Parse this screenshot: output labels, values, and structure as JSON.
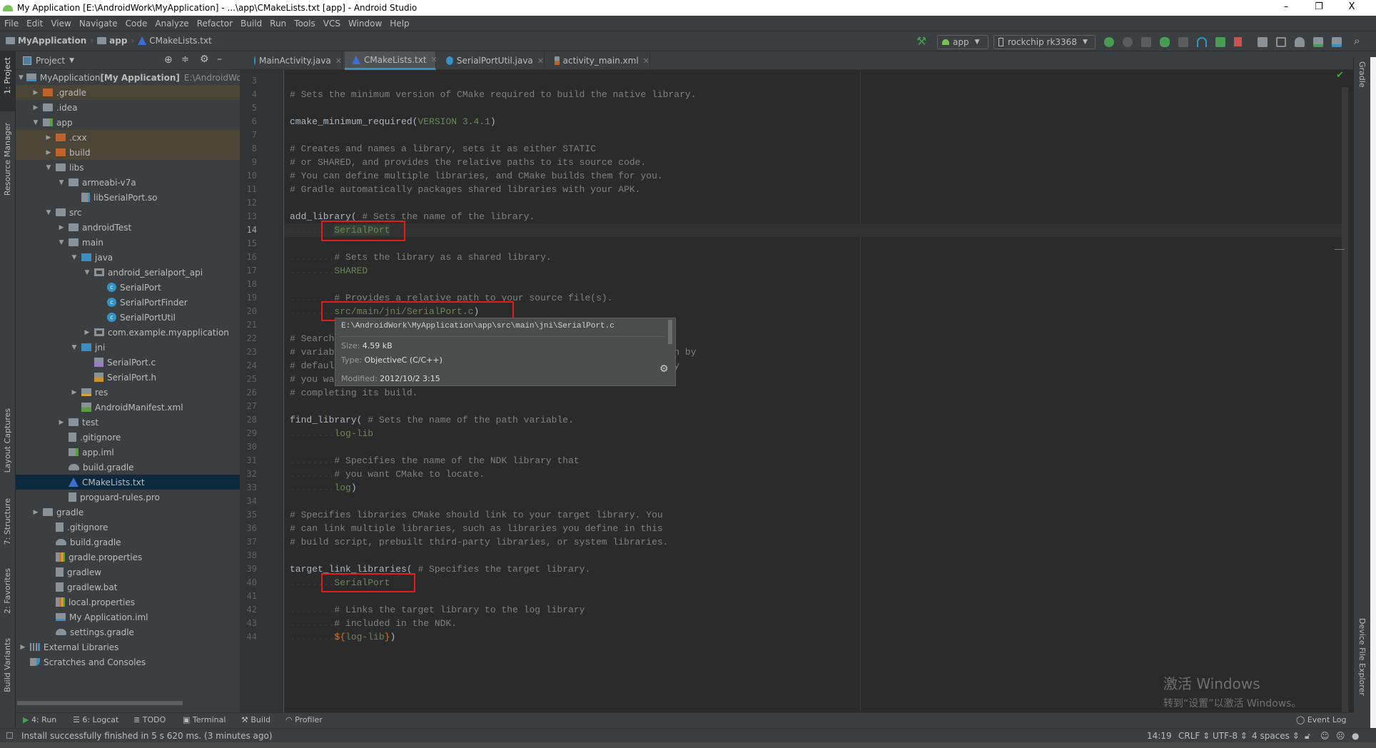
{
  "window": {
    "title": "My Application [E:\\AndroidWork\\MyApplication] - ...\\app\\CMakeLists.txt [app] - Android Studio",
    "controls": [
      "–",
      "❐",
      "X"
    ]
  },
  "menu": [
    "File",
    "Edit",
    "View",
    "Navigate",
    "Code",
    "Analyze",
    "Refactor",
    "Build",
    "Run",
    "Tools",
    "VCS",
    "Window",
    "Help"
  ],
  "breadcrumb": [
    "MyApplication",
    "app",
    "CMakeLists.txt"
  ],
  "toolbar": {
    "run_config": "app",
    "device": "rockchip rk3368",
    "icons": [
      "hammer-icon",
      "rerun-icon",
      "apply-changes-icon",
      "apply-code-changes-icon",
      "debug-icon",
      "attach-debugger-icon",
      "profile-icon",
      "debug-attach-icon",
      "stop-icon",
      "project-structure-icon",
      "avd-manager-icon",
      "gradle-sync-icon",
      "sdk-manager-icon",
      "device-manager-icon",
      "search-icon"
    ],
    "stop_color": "#c75450",
    "build_color": "#499c54"
  },
  "left_stripe": [
    "1: Project",
    "Resource Manager",
    "Layout Captures",
    "7: Structure",
    "2: Favorites",
    "Build Variants"
  ],
  "right_stripe": [
    "Gradle",
    "Device File Explorer"
  ],
  "project_panel": {
    "title": "Project",
    "tree": [
      {
        "label": "MyApplication",
        "bold": "[My Application]",
        "path": "E:\\AndroidWork\\MyApplication",
        "level": 0,
        "arrow": "down",
        "icon": "module"
      },
      {
        "label": ".gradle",
        "level": 1,
        "arrow": "right",
        "icon": "folder-excluded",
        "state": "excluded"
      },
      {
        "label": ".idea",
        "level": 1,
        "arrow": "right",
        "icon": "folder"
      },
      {
        "label": "app",
        "level": 1,
        "arrow": "down",
        "icon": "module-app"
      },
      {
        "label": ".cxx",
        "level": 2,
        "arrow": "right",
        "icon": "folder-excluded",
        "state": "excluded"
      },
      {
        "label": "build",
        "level": 2,
        "arrow": "right",
        "icon": "folder-excluded",
        "state": "excluded"
      },
      {
        "label": "libs",
        "level": 2,
        "arrow": "down",
        "icon": "folder"
      },
      {
        "label": "armeabi-v7a",
        "level": 3,
        "arrow": "down",
        "icon": "folder"
      },
      {
        "label": "libSerialPort.so",
        "level": 4,
        "icon": "so"
      },
      {
        "label": "src",
        "level": 2,
        "arrow": "down",
        "icon": "folder"
      },
      {
        "label": "androidTest",
        "level": 3,
        "arrow": "right",
        "icon": "folder"
      },
      {
        "label": "main",
        "level": 3,
        "arrow": "down",
        "icon": "folder"
      },
      {
        "label": "java",
        "level": 4,
        "arrow": "down",
        "icon": "folder-source"
      },
      {
        "label": "android_serialport_api",
        "level": 5,
        "arrow": "down",
        "icon": "package"
      },
      {
        "label": "SerialPort",
        "level": 6,
        "icon": "class"
      },
      {
        "label": "SerialPortFinder",
        "level": 6,
        "icon": "class"
      },
      {
        "label": "SerialPortUtil",
        "level": 6,
        "icon": "class"
      },
      {
        "label": "com.example.myapplication",
        "level": 5,
        "arrow": "right",
        "icon": "package"
      },
      {
        "label": "jni",
        "level": 4,
        "arrow": "down",
        "icon": "folder-source"
      },
      {
        "label": "SerialPort.c",
        "level": 5,
        "icon": "file-c"
      },
      {
        "label": "SerialPort.h",
        "level": 5,
        "icon": "file-h"
      },
      {
        "label": "res",
        "level": 4,
        "arrow": "right",
        "icon": "folder-res"
      },
      {
        "label": "AndroidManifest.xml",
        "level": 4,
        "icon": "manifest"
      },
      {
        "label": "test",
        "level": 3,
        "arrow": "right",
        "icon": "folder"
      },
      {
        "label": ".gitignore",
        "level": 3,
        "icon": "file"
      },
      {
        "label": "app.iml",
        "level": 3,
        "icon": "module-app"
      },
      {
        "label": "build.gradle",
        "level": 3,
        "icon": "gradle"
      },
      {
        "label": "CMakeLists.txt",
        "level": 3,
        "icon": "cmake",
        "state": "selected"
      },
      {
        "label": "proguard-rules.pro",
        "level": 3,
        "icon": "file"
      },
      {
        "label": "gradle",
        "level": 1,
        "arrow": "right",
        "icon": "folder"
      },
      {
        "label": ".gitignore",
        "level": 2,
        "icon": "file"
      },
      {
        "label": "build.gradle",
        "level": 2,
        "icon": "gradle"
      },
      {
        "label": "gradle.properties",
        "level": 2,
        "icon": "props"
      },
      {
        "label": "gradlew",
        "level": 2,
        "icon": "file"
      },
      {
        "label": "gradlew.bat",
        "level": 2,
        "icon": "file"
      },
      {
        "label": "local.properties",
        "level": 2,
        "icon": "props"
      },
      {
        "label": "My Application.iml",
        "level": 2,
        "icon": "module"
      },
      {
        "label": "settings.gradle",
        "level": 2,
        "icon": "gradle"
      },
      {
        "label": "External Libraries",
        "level": 0,
        "arrow": "right",
        "icon": "libs"
      },
      {
        "label": "Scratches and Consoles",
        "level": 0,
        "icon": "scratch"
      }
    ]
  },
  "tabs": [
    {
      "label": "MainActivity.java",
      "icon": "class"
    },
    {
      "label": "CMakeLists.txt",
      "icon": "cmake",
      "active": true
    },
    {
      "label": "SerialPortUtil.java",
      "icon": "class"
    },
    {
      "label": "activity_main.xml",
      "icon": "xml"
    }
  ],
  "editor": {
    "current_line": 14,
    "lines": [
      {
        "n": 3,
        "seg": []
      },
      {
        "n": 4,
        "seg": [
          [
            "c",
            "# Sets the minimum version of CMake required to build the native library."
          ]
        ]
      },
      {
        "n": 5,
        "seg": []
      },
      {
        "n": 6,
        "seg": [
          [
            "f",
            "cmake_minimum_required"
          ],
          [
            "p",
            "("
          ],
          [
            "s",
            "VERSION 3.4.1"
          ],
          [
            "p",
            ")"
          ]
        ]
      },
      {
        "n": 7,
        "seg": []
      },
      {
        "n": 8,
        "seg": [
          [
            "c",
            "# Creates and names a library, sets it as either STATIC"
          ]
        ]
      },
      {
        "n": 9,
        "seg": [
          [
            "c",
            "# or SHARED, and provides the relative paths to its source code."
          ]
        ]
      },
      {
        "n": 10,
        "seg": [
          [
            "c",
            "# You can define multiple libraries, and CMake builds them for you."
          ]
        ]
      },
      {
        "n": 11,
        "seg": [
          [
            "c",
            "# Gradle automatically packages shared libraries with your APK."
          ]
        ]
      },
      {
        "n": 12,
        "seg": []
      },
      {
        "n": 13,
        "seg": [
          [
            "f",
            "add_library( "
          ],
          [
            "c",
            "# Sets the name of the library."
          ]
        ]
      },
      {
        "n": 14,
        "seg": [
          [
            "ws",
            "........"
          ],
          [
            "s hl",
            "SerialPort"
          ]
        ]
      },
      {
        "n": 15,
        "seg": []
      },
      {
        "n": 16,
        "seg": [
          [
            "ws",
            "........"
          ],
          [
            "c",
            "# Sets the library as a shared library."
          ]
        ]
      },
      {
        "n": 17,
        "seg": [
          [
            "ws",
            "........"
          ],
          [
            "s",
            "SHARED"
          ]
        ]
      },
      {
        "n": 18,
        "seg": []
      },
      {
        "n": 19,
        "seg": [
          [
            "ws",
            "........"
          ],
          [
            "c",
            "# Provides a relative path to your source file(s)."
          ]
        ]
      },
      {
        "n": 20,
        "seg": [
          [
            "ws",
            "........"
          ],
          [
            "s",
            "src/main/jni/SerialPort.c"
          ],
          [
            "p",
            ")"
          ]
        ]
      },
      {
        "n": 21,
        "seg": []
      },
      {
        "n": 22,
        "seg": [
          [
            "c",
            "# Searches for a specified prebuilt library and stores the path as a"
          ]
        ]
      },
      {
        "n": 23,
        "seg": [
          [
            "c",
            "# variable. Because CMake includes system libraries in the search path by"
          ]
        ]
      },
      {
        "n": 24,
        "seg": [
          [
            "c",
            "# default, you only need to specify the name of the public NDK library"
          ]
        ]
      },
      {
        "n": 25,
        "seg": [
          [
            "c",
            "# you want to add. CMake verifies that the library exists before"
          ]
        ]
      },
      {
        "n": 26,
        "seg": [
          [
            "c",
            "# completing its build."
          ]
        ]
      },
      {
        "n": 27,
        "seg": []
      },
      {
        "n": 28,
        "seg": [
          [
            "f",
            "find_library( "
          ],
          [
            "c",
            "# Sets the name of the path variable."
          ]
        ]
      },
      {
        "n": 29,
        "seg": [
          [
            "ws",
            "........"
          ],
          [
            "s",
            "log-lib"
          ]
        ]
      },
      {
        "n": 30,
        "seg": []
      },
      {
        "n": 31,
        "seg": [
          [
            "ws",
            "........"
          ],
          [
            "c",
            "# Specifies the name of the NDK library that"
          ]
        ]
      },
      {
        "n": 32,
        "seg": [
          [
            "ws",
            "........"
          ],
          [
            "c",
            "# you want CMake to locate."
          ]
        ]
      },
      {
        "n": 33,
        "seg": [
          [
            "ws",
            "........"
          ],
          [
            "s",
            "log"
          ],
          [
            "p",
            ")"
          ]
        ]
      },
      {
        "n": 34,
        "seg": []
      },
      {
        "n": 35,
        "seg": [
          [
            "c",
            "# Specifies libraries CMake should link to your target library. You"
          ]
        ]
      },
      {
        "n": 36,
        "seg": [
          [
            "c",
            "# can link multiple libraries, such as libraries you define in this"
          ]
        ]
      },
      {
        "n": 37,
        "seg": [
          [
            "c",
            "# build script, prebuilt third-party libraries, or system libraries."
          ]
        ]
      },
      {
        "n": 38,
        "seg": []
      },
      {
        "n": 39,
        "seg": [
          [
            "f",
            "target_link_libraries( "
          ],
          [
            "c",
            "# Specifies the target library."
          ]
        ]
      },
      {
        "n": 40,
        "seg": [
          [
            "ws",
            "........"
          ],
          [
            "s",
            "SerialPort"
          ]
        ]
      },
      {
        "n": 41,
        "seg": []
      },
      {
        "n": 42,
        "seg": [
          [
            "ws",
            "........"
          ],
          [
            "c",
            "# Links the target library to the log library"
          ]
        ]
      },
      {
        "n": 43,
        "seg": [
          [
            "ws",
            "........"
          ],
          [
            "c",
            "# included in the NDK."
          ]
        ]
      },
      {
        "n": 44,
        "seg": [
          [
            "ws",
            "........"
          ],
          [
            "k",
            "${"
          ],
          [
            "s",
            "log-lib"
          ],
          [
            "k",
            "}"
          ],
          [
            "p",
            ")"
          ]
        ]
      }
    ],
    "highlight_color": "#e01e1e"
  },
  "tooltip": {
    "path": "E:\\AndroidWork\\MyApplication\\app\\src\\main\\jni\\SerialPort.c",
    "size_label": "Size:",
    "size": "4.59 kB",
    "type_label": "Type:",
    "type": "ObjectiveC (C/C++)",
    "modified_label": "Modified:",
    "modified": "2012/10/2 3:15"
  },
  "watermark": {
    "line1": "激活 Windows",
    "line2": "转到“设置”以激活 Windows。"
  },
  "bottom_tools": [
    "4: Run",
    "6: Logcat",
    "TODO",
    "Terminal",
    "Build",
    "Profiler"
  ],
  "event_log": "Event Log",
  "status": {
    "message": "Install successfully finished in 5 s 620 ms. (3 minutes ago)",
    "position": "14:19",
    "line_sep": "CRLF ⇕",
    "encoding": "UTF-8 ⇕",
    "indent": "4 spaces ⇕"
  }
}
